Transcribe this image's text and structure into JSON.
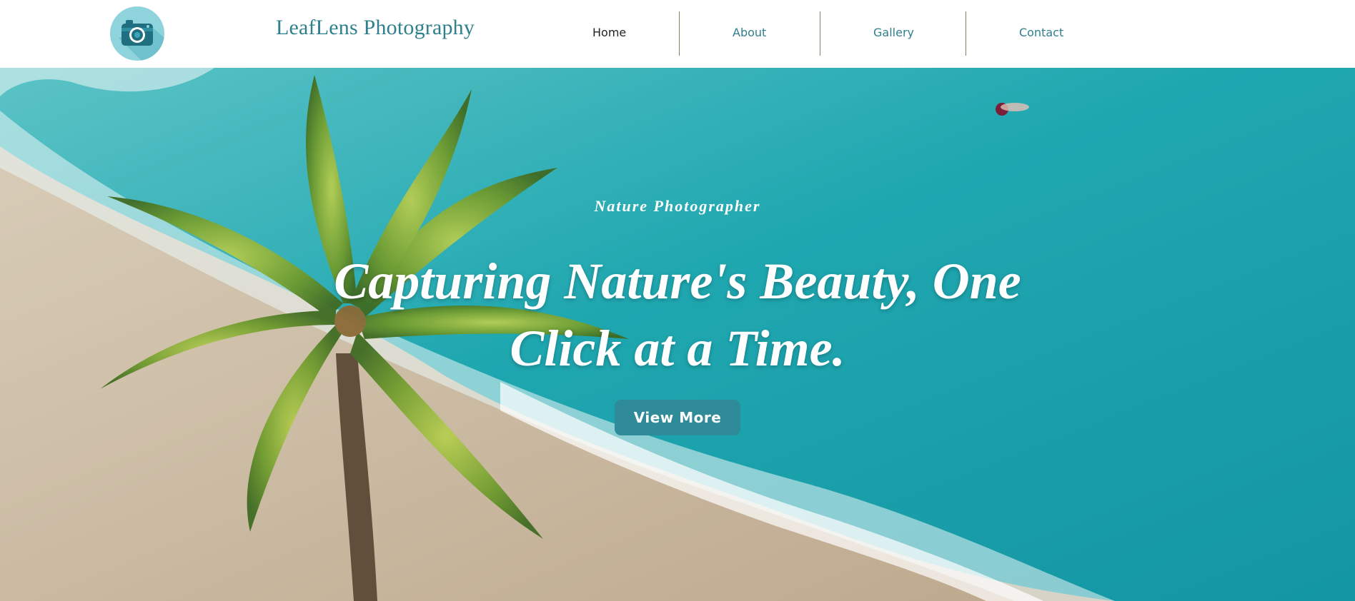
{
  "header": {
    "logo_icon": "camera-icon",
    "brand": "LeafLens Photography",
    "nav": [
      {
        "label": "Home",
        "active": true
      },
      {
        "label": "About",
        "active": false
      },
      {
        "label": "Gallery",
        "active": false
      },
      {
        "label": "Contact",
        "active": false
      }
    ]
  },
  "hero": {
    "subtitle": "Nature Photographer",
    "title": "Capturing Nature's Beauty, One Click at a Time.",
    "cta_label": "View More",
    "background": "aerial beach photo with palm tree"
  },
  "colors": {
    "brand": "#2f7f8d",
    "button": "#2f8b98",
    "sea": "#1aa3ad",
    "sand": "#c8b8a0"
  }
}
